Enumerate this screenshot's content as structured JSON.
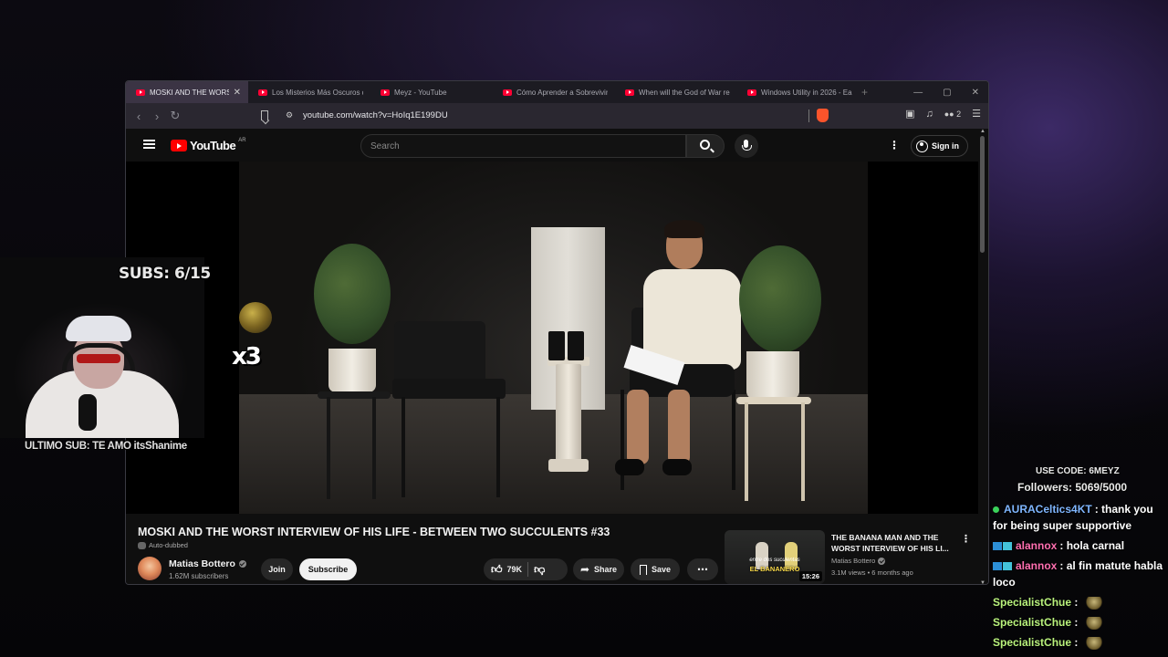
{
  "browser": {
    "tabs": [
      {
        "title": "MOSKI AND THE WORST INTERVIEW OF HIS LIFE",
        "active": true
      },
      {
        "title": "Los Misterios Más Oscuros de",
        "active": false
      },
      {
        "title": "Meyz - YouTube",
        "active": false
      },
      {
        "title": "Cómo Aprender a Sobrevivir",
        "active": false
      },
      {
        "title": "When will the God of War re",
        "active": false
      },
      {
        "title": "Windows Utility in 2026 - Ea",
        "active": false
      }
    ],
    "url": "youtube.com/watch?v=HoIq1E199DU",
    "badge_count": "2"
  },
  "youtube": {
    "logo_text": "YouTube",
    "country_code": "AR",
    "search_placeholder": "Search",
    "sign_in": "Sign in",
    "video": {
      "title": "MOSKI AND THE WORST INTERVIEW OF HIS LIFE - BETWEEN TWO SUCCULENTS #33",
      "auto_dubbed": "Auto-dubbed",
      "channel": "Matias Bottero",
      "subscribers": "1.62M subscribers",
      "join": "Join",
      "subscribe": "Subscribe",
      "likes": "79K",
      "share": "Share",
      "save": "Save"
    },
    "recommended": {
      "title": "THE BANANA MAN AND THE WORST INTERVIEW OF HIS LI...",
      "channel": "Matias Bottero",
      "meta": "3.1M views • 6 months ago",
      "duration": "15:26",
      "thumb_caption": "EL BANANERO",
      "thumb_subcaption": "entre dos suculentas"
    }
  },
  "overlay": {
    "subs_goal": "SUBS: 6/15",
    "last_sub": "ULTIMO SUB: TE AMO itsShanime",
    "multiplier": "x3",
    "use_code": "USE CODE: 6MEYZ",
    "followers": "Followers: 5069/5000",
    "chat": [
      {
        "user": "AURACeltics4KT",
        "text": ": thank you for being super supportive",
        "user_color": "#7fb6ff",
        "badge": "dot"
      },
      {
        "user": "alannox",
        "text": ": hola carnal",
        "user_color": "#ff6fb0",
        "badge": "squares"
      },
      {
        "user": "alannox",
        "text": ": al fin matute habla loco",
        "user_color": "#ff6fb0",
        "badge": "squares"
      },
      {
        "user": "SpecialistChue",
        "text": " :",
        "user_color": "#b9f27c",
        "badge": "none",
        "emote": true
      },
      {
        "user": "SpecialistChue",
        "text": " :",
        "user_color": "#b9f27c",
        "badge": "none",
        "emote": true
      },
      {
        "user": "SpecialistChue",
        "text": " :",
        "user_color": "#b9f27c",
        "badge": "none",
        "emote": true
      }
    ]
  }
}
